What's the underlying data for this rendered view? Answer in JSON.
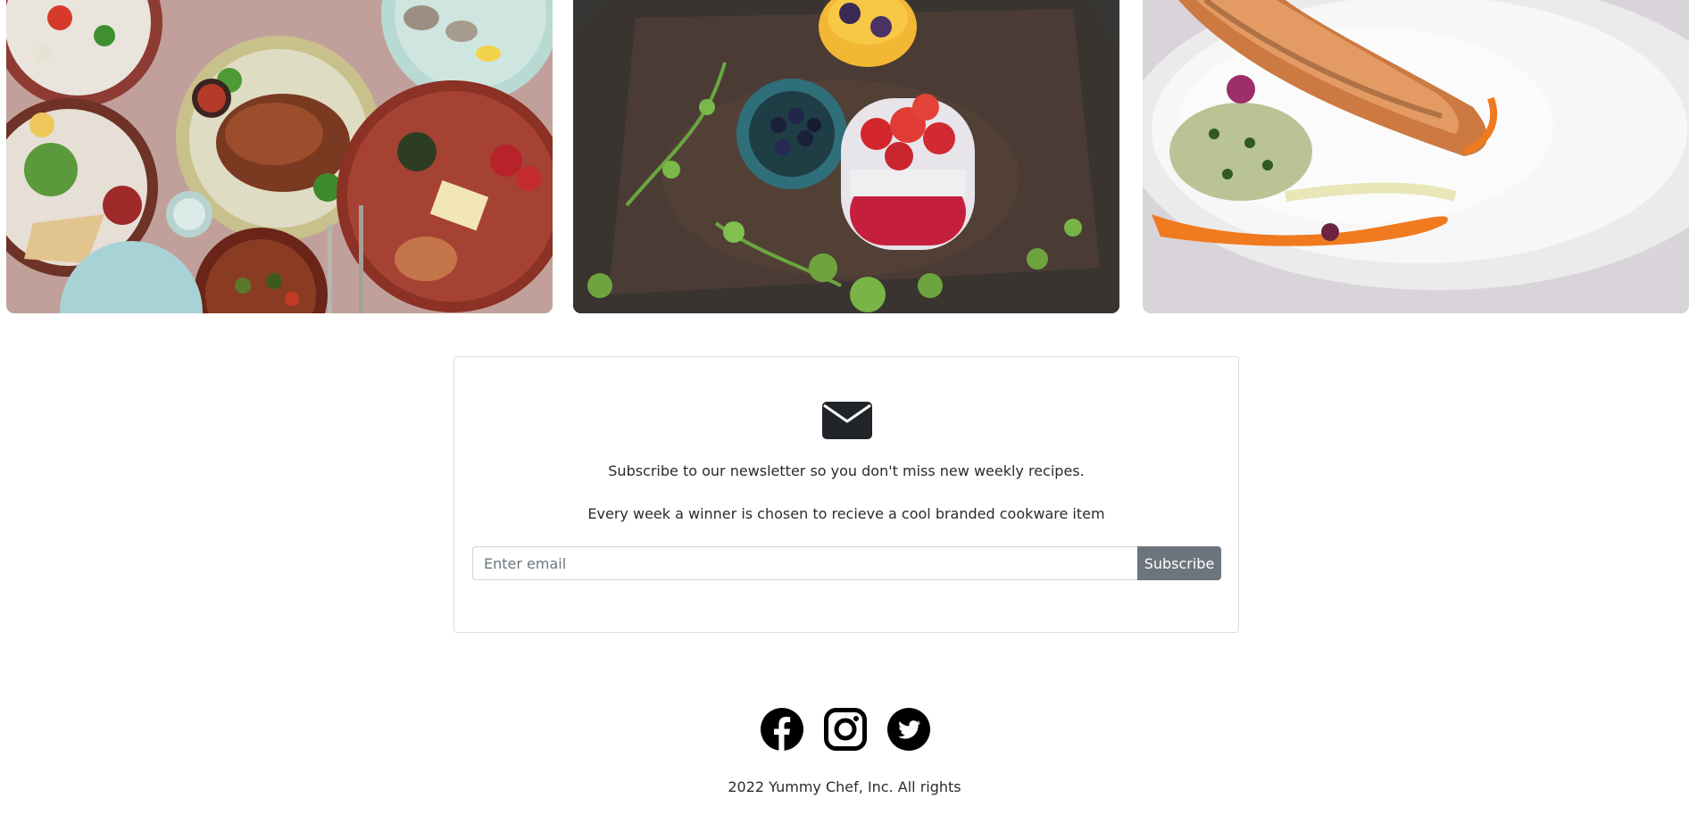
{
  "gallery": {
    "images": [
      {
        "alt": "food-spread-photo"
      },
      {
        "alt": "berries-dessert-photo"
      },
      {
        "alt": "salmon-dish-photo"
      }
    ]
  },
  "newsletter": {
    "icon": "envelope-icon",
    "line1": "Subscribe to our newsletter so you don't miss new weekly recipes.",
    "line2": "Every week a winner is chosen to recieve a cool branded cookware item",
    "email_placeholder": "Enter email",
    "email_value": "",
    "subscribe_label": "Subscribe",
    "button_color": "#6c757d"
  },
  "footer": {
    "social": [
      {
        "name": "facebook-icon"
      },
      {
        "name": "instagram-icon"
      },
      {
        "name": "twitter-icon"
      }
    ],
    "copyright": "2022 Yummy Chef, Inc. All rights"
  }
}
